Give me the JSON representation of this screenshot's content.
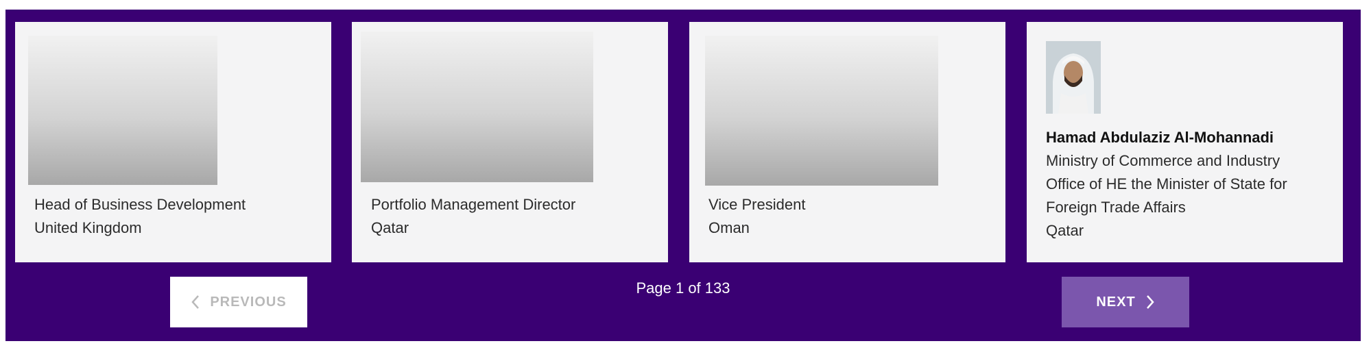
{
  "cards": [
    {
      "name": "",
      "line1": "Head of Business Development",
      "line2": "United Kingdom"
    },
    {
      "name": "",
      "line1": "Portfolio Management Director",
      "line2": "Qatar"
    },
    {
      "name": "",
      "line1": "Vice President",
      "line2": "Oman"
    },
    {
      "name": "Hamad Abdulaziz Al-Mohannadi",
      "line1": "Ministry of Commerce and Industry",
      "line2": "Office of HE the Minister of State for",
      "line3": "Foreign Trade Affairs",
      "line4": "Qatar"
    }
  ],
  "pagination": {
    "previous_label": "PREVIOUS",
    "next_label": "NEXT",
    "page_text": "Page 1 of 133",
    "prev_icon": "chevron-left-icon",
    "next_icon": "chevron-right-icon"
  },
  "colors": {
    "panel_background": "#3a0073",
    "card_background": "#f4f4f5",
    "next_button": "#7b56ad",
    "previous_button": "#ffffff",
    "previous_text": "#b9b9b9"
  }
}
